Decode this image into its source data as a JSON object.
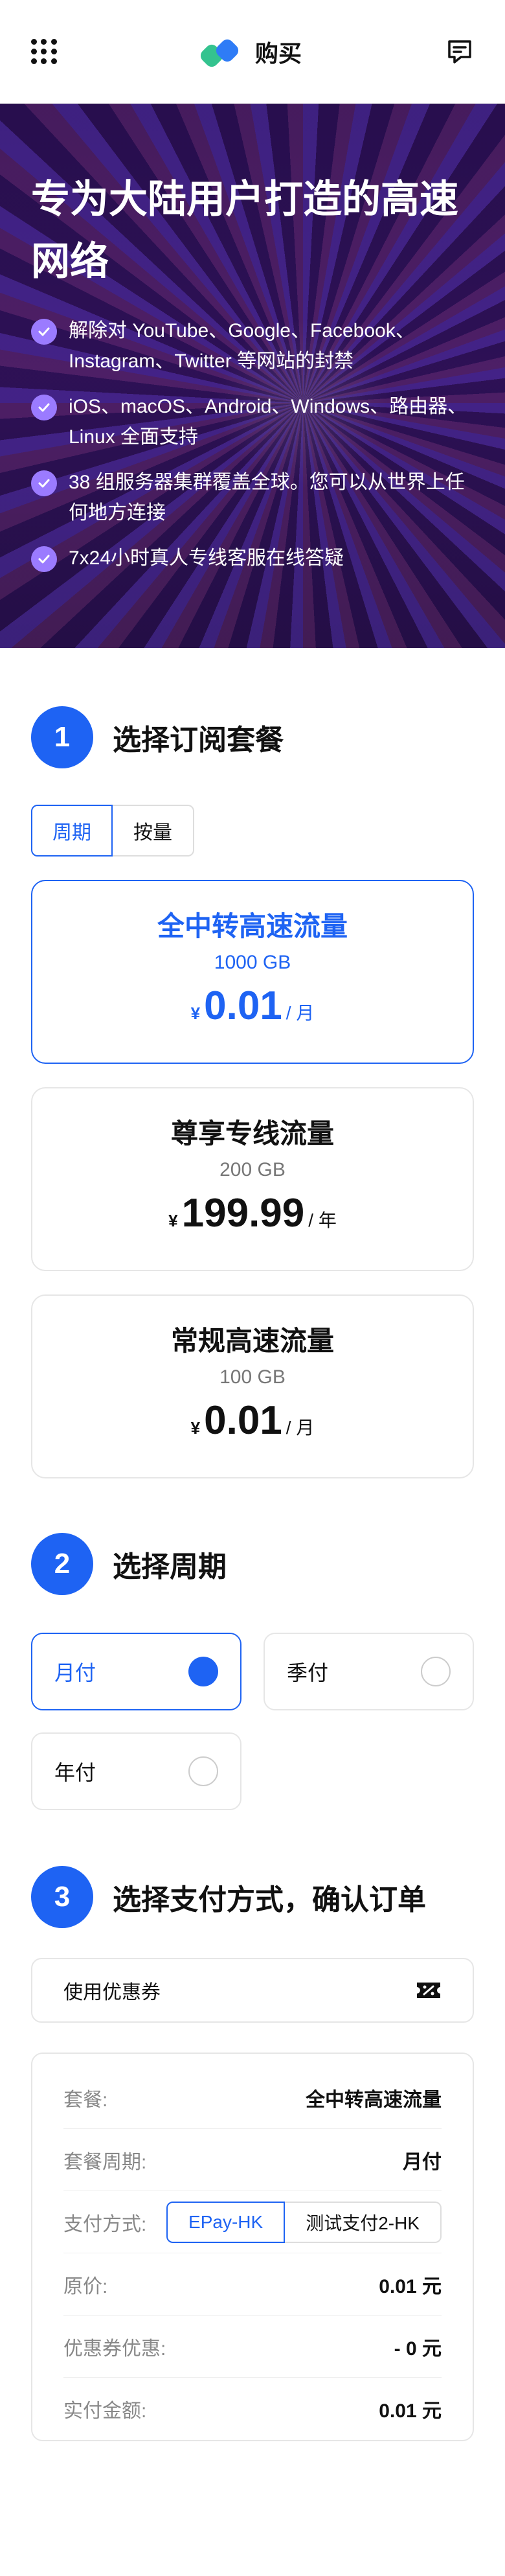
{
  "header": {
    "brand": "购买",
    "menu_icon": "grid-menu-icon",
    "message_icon": "chat-icon"
  },
  "hero": {
    "title": "专为大陆用户打造的高速网络",
    "features": [
      "解除对 YouTube、Google、Facebook、Instagram、Twitter 等网站的封禁",
      "iOS、macOS、Android、Windows、路由器、Linux 全面支持",
      "38 组服务器集群覆盖全球。您可以从世界上任何地方连接",
      "7x24小时真人专线客服在线答疑"
    ]
  },
  "step1": {
    "number": "1",
    "title": "选择订阅套餐",
    "tabs": [
      "周期",
      "按量"
    ],
    "plans": [
      {
        "name": "全中转高速流量",
        "size": "1000 GB",
        "currency": "¥",
        "price": "0.01",
        "unit": "/ 月"
      },
      {
        "name": "尊享专线流量",
        "size": "200 GB",
        "currency": "¥",
        "price": "199.99",
        "unit": "/ 年"
      },
      {
        "name": "常规高速流量",
        "size": "100 GB",
        "currency": "¥",
        "price": "0.01",
        "unit": "/ 月"
      }
    ]
  },
  "step2": {
    "number": "2",
    "title": "选择周期",
    "periods": [
      "月付",
      "季付",
      "年付"
    ]
  },
  "step3": {
    "number": "3",
    "title": "选择支付方式，确认订单",
    "coupon_label": "使用优惠券",
    "summary": {
      "plan_label": "套餐:",
      "plan_value": "全中转高速流量",
      "period_label": "套餐周期:",
      "period_value": "月付",
      "payment_label": "支付方式:",
      "payment_options": [
        "EPay-HK",
        "测试支付2-HK"
      ],
      "original_label": "原价:",
      "original_value": "0.01 元",
      "discount_label": "优惠券优惠:",
      "discount_value": "- 0 元",
      "total_label": "实付金额:",
      "total_value": "0.01 元"
    }
  },
  "colors": {
    "accent": "#1e63f3",
    "check": "#9b7bff"
  }
}
